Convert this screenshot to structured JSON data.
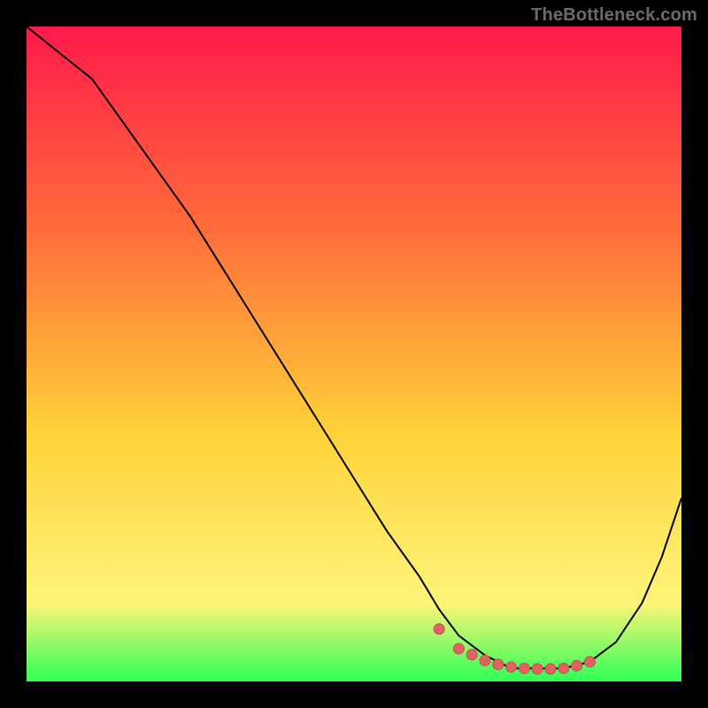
{
  "watermark": "TheBottleneck.com",
  "colors": {
    "black": "#000000",
    "curve": "#000000",
    "marker_fill": "#e06363",
    "marker_stroke": "#c45050",
    "grad_top": "#ff1a4a",
    "grad_mid1": "#ff6a3a",
    "grad_mid2": "#ffd23a",
    "grad_mid3": "#fff47a",
    "grad_bottom": "#2dff55"
  },
  "chart_data": {
    "type": "line",
    "title": "",
    "xlabel": "",
    "ylabel": "",
    "xlim": [
      0,
      100
    ],
    "ylim": [
      0,
      100
    ],
    "grid": false,
    "series": [
      {
        "name": "bottleneck-curve",
        "x": [
          0,
          5,
          10,
          15,
          20,
          25,
          30,
          35,
          40,
          45,
          50,
          55,
          60,
          63,
          66,
          70,
          74,
          78,
          82,
          86,
          90,
          94,
          97,
          100
        ],
        "values": [
          100,
          96,
          92,
          85,
          78,
          71,
          63,
          55,
          47,
          39,
          31,
          23,
          16,
          11,
          7,
          4,
          2,
          2,
          2,
          3,
          6,
          12,
          19,
          28
        ]
      }
    ],
    "markers": {
      "name": "highlight-dots",
      "x": [
        63,
        66,
        68,
        70,
        72,
        74,
        76,
        78,
        80,
        82,
        84,
        86
      ],
      "values": [
        8,
        5,
        4.1,
        3.2,
        2.6,
        2.2,
        2.0,
        1.9,
        1.9,
        2.0,
        2.4,
        3.0
      ]
    }
  }
}
